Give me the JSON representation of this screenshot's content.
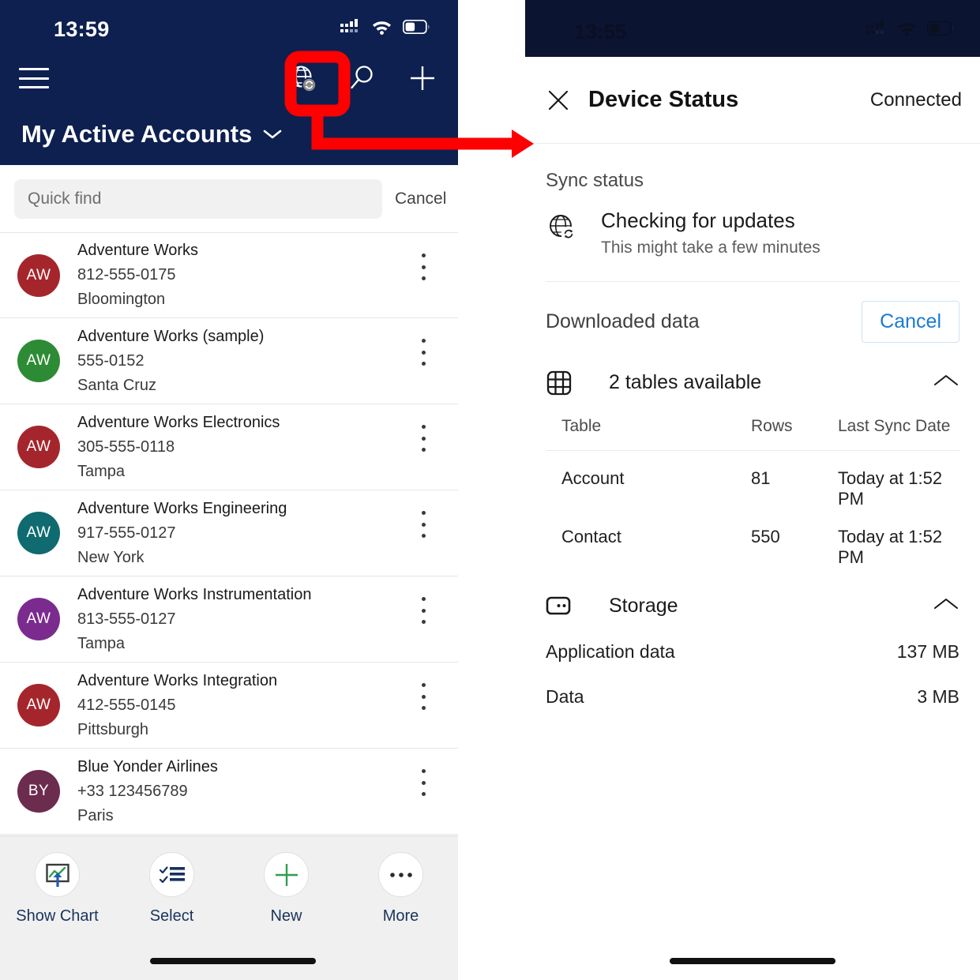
{
  "left_phone": {
    "status_bar": {
      "time": "13:59",
      "signal_icon": "signal-bars-icon",
      "wifi_icon": "wifi-icon",
      "battery_icon": "battery-icon"
    },
    "nav": {
      "menu_icon": "hamburger-menu-icon",
      "sync_icon": "globe-sync-icon",
      "search_icon": "search-icon",
      "new_icon": "plus-icon"
    },
    "view_selector": {
      "label": "My Active Accounts",
      "chevron_icon": "chevron-down-icon"
    },
    "search": {
      "placeholder": "Quick find",
      "value": "",
      "cancel_label": "Cancel"
    },
    "accounts": [
      {
        "initials": "AW",
        "color": "#a4262c",
        "name": "Adventure Works",
        "phone": "812-555-0175",
        "city": "Bloomington"
      },
      {
        "initials": "AW",
        "color": "#2e8b35",
        "name": "Adventure Works (sample)",
        "phone": "555-0152",
        "city": "Santa Cruz"
      },
      {
        "initials": "AW",
        "color": "#a4262c",
        "name": "Adventure Works Electronics",
        "phone": "305-555-0118",
        "city": "Tampa"
      },
      {
        "initials": "AW",
        "color": "#0f6b70",
        "name": "Adventure Works Engineering",
        "phone": "917-555-0127",
        "city": "New York"
      },
      {
        "initials": "AW",
        "color": "#7b2b8e",
        "name": "Adventure Works Instrumentation",
        "phone": "813-555-0127",
        "city": "Tampa"
      },
      {
        "initials": "AW",
        "color": "#a4262c",
        "name": "Adventure Works Integration",
        "phone": "412-555-0145",
        "city": "Pittsburgh"
      },
      {
        "initials": "BY",
        "color": "#6b2c4e",
        "name": "Blue Yonder Airlines",
        "phone": "+33 123456789",
        "city": "Paris"
      }
    ],
    "command_bar": [
      {
        "label": "Show Chart",
        "icon": "show-chart-icon"
      },
      {
        "label": "Select",
        "icon": "checklist-icon"
      },
      {
        "label": "New",
        "icon": "plus-icon"
      },
      {
        "label": "More",
        "icon": "ellipsis-icon"
      }
    ]
  },
  "right_phone": {
    "status_bar": {
      "time": "13:55",
      "signal_icon": "signal-bars-icon",
      "wifi_icon": "wifi-icon",
      "battery_icon": "battery-icon"
    },
    "header": {
      "close_icon": "close-icon",
      "title": "Device Status",
      "connection_status": "Connected"
    },
    "sync_status": {
      "section_label": "Sync status",
      "icon": "globe-sync-icon",
      "title": "Checking for updates",
      "subtitle": "This might take a few minutes"
    },
    "downloaded_data": {
      "label": "Downloaded data",
      "cancel_label": "Cancel",
      "group": {
        "icon": "table-grid-icon",
        "title": "2 tables available",
        "chevron_icon": "chevron-up-icon"
      },
      "columns": [
        "Table",
        "Rows",
        "Last Sync Date"
      ],
      "rows": [
        {
          "table": "Account",
          "rows": "81",
          "last_sync": "Today at 1:52 PM"
        },
        {
          "table": "Contact",
          "rows": "550",
          "last_sync": "Today at 1:52 PM"
        }
      ]
    },
    "storage": {
      "group": {
        "icon": "storage-drive-icon",
        "title": "Storage",
        "chevron_icon": "chevron-up-icon"
      },
      "items": [
        {
          "key": "Application data",
          "value": "137 MB"
        },
        {
          "key": "Data",
          "value": "3 MB"
        }
      ]
    }
  },
  "annotation": {
    "color": "#fe0000",
    "highlight_target": "globe-sync-icon"
  }
}
